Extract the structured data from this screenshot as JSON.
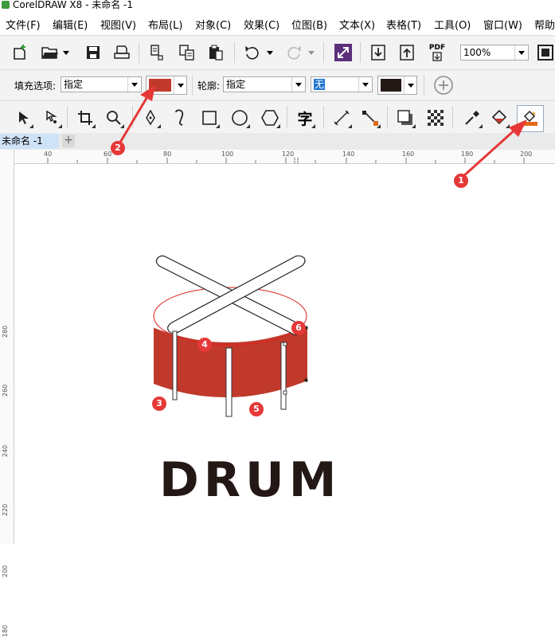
{
  "window": {
    "title": "CorelDRAW X8 - 未命名 -1"
  },
  "menu": [
    "文件(F)",
    "编辑(E)",
    "视图(V)",
    "布局(L)",
    "对象(C)",
    "效果(C)",
    "位图(B)",
    "文本(X)",
    "表格(T)",
    "工具(O)",
    "窗口(W)",
    "帮助"
  ],
  "toolbar": {
    "zoom_value": "100%",
    "pdf_label": "PDF"
  },
  "property_bar": {
    "fill_label": "填充选项:",
    "fill_value": "指定",
    "fill_color": "#c0392b",
    "outline_label": "轮廓:",
    "outline_value": "指定",
    "outline_width": "无",
    "outline_color": "#231815"
  },
  "toolbox": {
    "text_tool_glyph": "字"
  },
  "tabs": {
    "document": "未命名 -1",
    "add": "+"
  },
  "rulers": {
    "horizontal": [
      "40",
      "60",
      "80",
      "100",
      "120",
      "140",
      "160",
      "180",
      "200"
    ],
    "vertical": [
      "280",
      "260",
      "240",
      "220",
      "200",
      "180"
    ]
  },
  "canvas": {
    "text": "DRUM",
    "drum_color": "#c0392b"
  },
  "annotations": [
    "1",
    "2",
    "3",
    "4",
    "5",
    "6"
  ]
}
